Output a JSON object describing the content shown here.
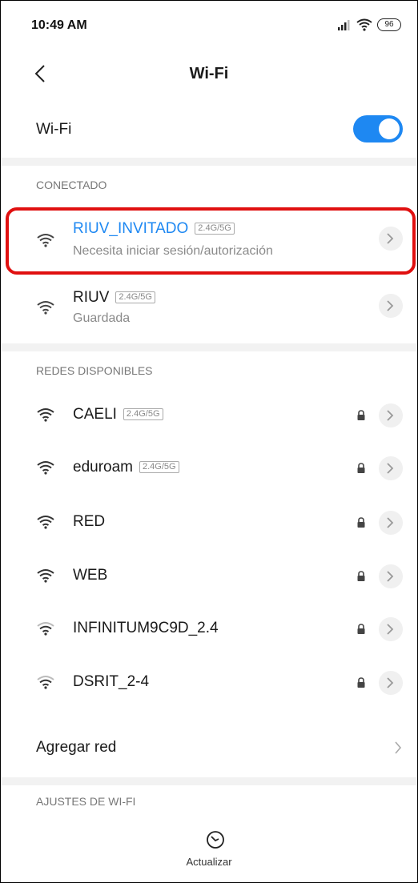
{
  "status_bar": {
    "time": "10:49 AM",
    "battery": "96"
  },
  "header": {
    "title": "Wi-Fi"
  },
  "wifi_toggle": {
    "label": "Wi-Fi",
    "state": "on"
  },
  "sections": {
    "connected": "CONECTADO",
    "available": "REDES DISPONIBLES",
    "settings": "AJUSTES DE WI-FI"
  },
  "connected_networks": [
    {
      "name": "RIUV_INVITADO",
      "band": "2.4G/5G",
      "status": "Necesita iniciar sesión/autorización"
    },
    {
      "name": "RIUV",
      "band": "2.4G/5G",
      "status": "Guardada"
    }
  ],
  "available_networks": [
    {
      "name": "CAELI",
      "band": "2.4G/5G"
    },
    {
      "name": "eduroam",
      "band": "2.4G/5G"
    },
    {
      "name": "RED"
    },
    {
      "name": "WEB"
    },
    {
      "name": "INFINITUM9C9D_2.4"
    },
    {
      "name": "DSRIT_2-4"
    }
  ],
  "add_network": {
    "label": "Agregar red"
  },
  "bottom": {
    "refresh_label": "Actualizar"
  },
  "colors": {
    "accent": "#1e88f2",
    "highlight": "#e01010"
  }
}
